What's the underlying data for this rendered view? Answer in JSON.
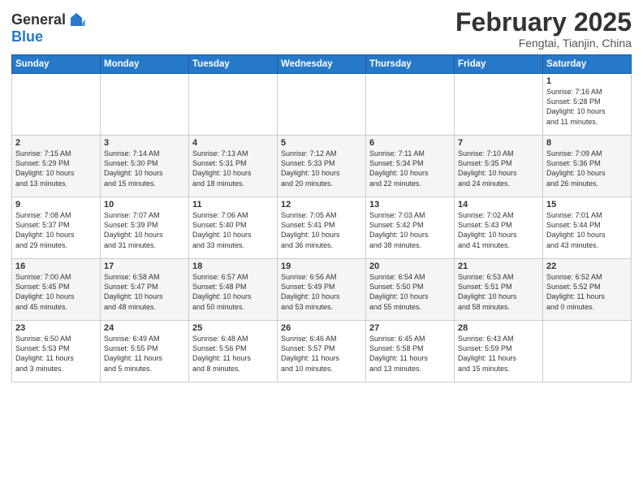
{
  "header": {
    "logo_general": "General",
    "logo_blue": "Blue",
    "month_title": "February 2025",
    "location": "Fengtai, Tianjin, China"
  },
  "weekdays": [
    "Sunday",
    "Monday",
    "Tuesday",
    "Wednesday",
    "Thursday",
    "Friday",
    "Saturday"
  ],
  "weeks": [
    [
      {
        "day": "",
        "info": ""
      },
      {
        "day": "",
        "info": ""
      },
      {
        "day": "",
        "info": ""
      },
      {
        "day": "",
        "info": ""
      },
      {
        "day": "",
        "info": ""
      },
      {
        "day": "",
        "info": ""
      },
      {
        "day": "1",
        "info": "Sunrise: 7:16 AM\nSunset: 5:28 PM\nDaylight: 10 hours\nand 11 minutes."
      }
    ],
    [
      {
        "day": "2",
        "info": "Sunrise: 7:15 AM\nSunset: 5:29 PM\nDaylight: 10 hours\nand 13 minutes."
      },
      {
        "day": "3",
        "info": "Sunrise: 7:14 AM\nSunset: 5:30 PM\nDaylight: 10 hours\nand 15 minutes."
      },
      {
        "day": "4",
        "info": "Sunrise: 7:13 AM\nSunset: 5:31 PM\nDaylight: 10 hours\nand 18 minutes."
      },
      {
        "day": "5",
        "info": "Sunrise: 7:12 AM\nSunset: 5:33 PM\nDaylight: 10 hours\nand 20 minutes."
      },
      {
        "day": "6",
        "info": "Sunrise: 7:11 AM\nSunset: 5:34 PM\nDaylight: 10 hours\nand 22 minutes."
      },
      {
        "day": "7",
        "info": "Sunrise: 7:10 AM\nSunset: 5:35 PM\nDaylight: 10 hours\nand 24 minutes."
      },
      {
        "day": "8",
        "info": "Sunrise: 7:09 AM\nSunset: 5:36 PM\nDaylight: 10 hours\nand 26 minutes."
      }
    ],
    [
      {
        "day": "9",
        "info": "Sunrise: 7:08 AM\nSunset: 5:37 PM\nDaylight: 10 hours\nand 29 minutes."
      },
      {
        "day": "10",
        "info": "Sunrise: 7:07 AM\nSunset: 5:39 PM\nDaylight: 10 hours\nand 31 minutes."
      },
      {
        "day": "11",
        "info": "Sunrise: 7:06 AM\nSunset: 5:40 PM\nDaylight: 10 hours\nand 33 minutes."
      },
      {
        "day": "12",
        "info": "Sunrise: 7:05 AM\nSunset: 5:41 PM\nDaylight: 10 hours\nand 36 minutes."
      },
      {
        "day": "13",
        "info": "Sunrise: 7:03 AM\nSunset: 5:42 PM\nDaylight: 10 hours\nand 38 minutes."
      },
      {
        "day": "14",
        "info": "Sunrise: 7:02 AM\nSunset: 5:43 PM\nDaylight: 10 hours\nand 41 minutes."
      },
      {
        "day": "15",
        "info": "Sunrise: 7:01 AM\nSunset: 5:44 PM\nDaylight: 10 hours\nand 43 minutes."
      }
    ],
    [
      {
        "day": "16",
        "info": "Sunrise: 7:00 AM\nSunset: 5:45 PM\nDaylight: 10 hours\nand 45 minutes."
      },
      {
        "day": "17",
        "info": "Sunrise: 6:58 AM\nSunset: 5:47 PM\nDaylight: 10 hours\nand 48 minutes."
      },
      {
        "day": "18",
        "info": "Sunrise: 6:57 AM\nSunset: 5:48 PM\nDaylight: 10 hours\nand 50 minutes."
      },
      {
        "day": "19",
        "info": "Sunrise: 6:56 AM\nSunset: 5:49 PM\nDaylight: 10 hours\nand 53 minutes."
      },
      {
        "day": "20",
        "info": "Sunrise: 6:54 AM\nSunset: 5:50 PM\nDaylight: 10 hours\nand 55 minutes."
      },
      {
        "day": "21",
        "info": "Sunrise: 6:53 AM\nSunset: 5:51 PM\nDaylight: 10 hours\nand 58 minutes."
      },
      {
        "day": "22",
        "info": "Sunrise: 6:52 AM\nSunset: 5:52 PM\nDaylight: 11 hours\nand 0 minutes."
      }
    ],
    [
      {
        "day": "23",
        "info": "Sunrise: 6:50 AM\nSunset: 5:53 PM\nDaylight: 11 hours\nand 3 minutes."
      },
      {
        "day": "24",
        "info": "Sunrise: 6:49 AM\nSunset: 5:55 PM\nDaylight: 11 hours\nand 5 minutes."
      },
      {
        "day": "25",
        "info": "Sunrise: 6:48 AM\nSunset: 5:56 PM\nDaylight: 11 hours\nand 8 minutes."
      },
      {
        "day": "26",
        "info": "Sunrise: 6:46 AM\nSunset: 5:57 PM\nDaylight: 11 hours\nand 10 minutes."
      },
      {
        "day": "27",
        "info": "Sunrise: 6:45 AM\nSunset: 5:58 PM\nDaylight: 11 hours\nand 13 minutes."
      },
      {
        "day": "28",
        "info": "Sunrise: 6:43 AM\nSunset: 5:59 PM\nDaylight: 11 hours\nand 15 minutes."
      },
      {
        "day": "",
        "info": ""
      }
    ]
  ]
}
